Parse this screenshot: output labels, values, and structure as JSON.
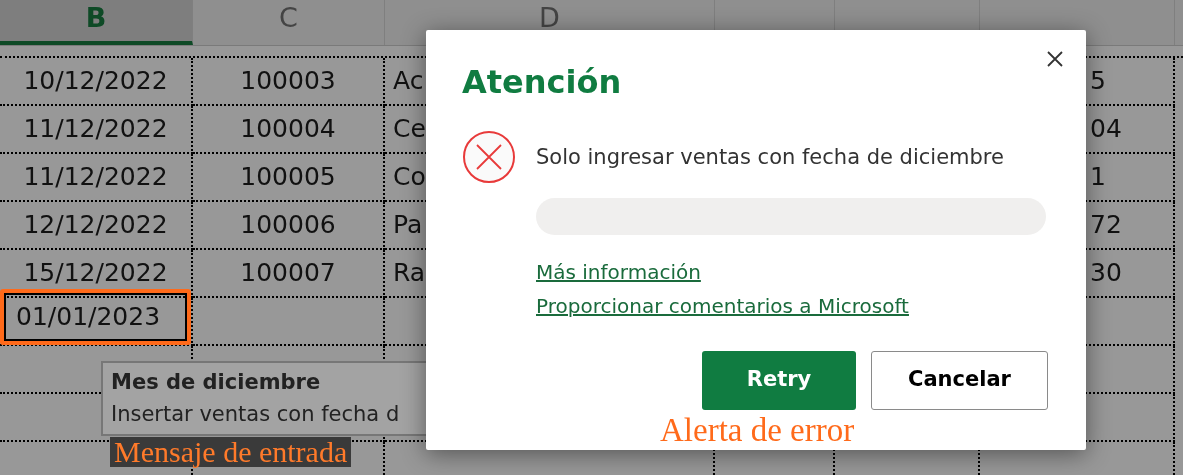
{
  "columns": [
    {
      "label": "B",
      "selected": true
    },
    {
      "label": "C",
      "selected": false
    },
    {
      "label": "D",
      "selected": false
    },
    {
      "selected": false
    },
    {
      "selected": false
    },
    {
      "selected": false
    }
  ],
  "rows": [
    {
      "selected": false,
      "cells": [
        "10/12/2022",
        "100003",
        "Ac",
        null,
        null,
        "5"
      ]
    },
    {
      "selected": false,
      "cells": [
        "11/12/2022",
        "100004",
        "Ce",
        null,
        null,
        "04"
      ]
    },
    {
      "selected": false,
      "cells": [
        "11/12/2022",
        "100005",
        "Co",
        null,
        null,
        "1"
      ]
    },
    {
      "selected": false,
      "cells": [
        "12/12/2022",
        "100006",
        "Pa",
        null,
        null,
        "72"
      ]
    },
    {
      "selected": false,
      "cells": [
        "15/12/2022",
        "100007",
        "Ra",
        null,
        null,
        "30"
      ]
    },
    {
      "selected": true,
      "cells": [
        "01/01/2023",
        null,
        null,
        null,
        null,
        null
      ]
    }
  ],
  "input_tooltip": {
    "title": "Mes de diciembre",
    "text": "Insertar ventas con fecha d"
  },
  "input_annotation": "Mensaje de entrada",
  "dialog": {
    "title": "Atención",
    "message": "Solo ingresar ventas con fecha de diciembre",
    "links": [
      "Más información",
      "Proporcionar comentarios a Microsoft"
    ],
    "buttons": [
      {
        "label": "Retry",
        "kind": "primary"
      },
      {
        "label": "Cancelar",
        "kind": "secondary"
      }
    ],
    "annotation": "Alerta de error"
  }
}
